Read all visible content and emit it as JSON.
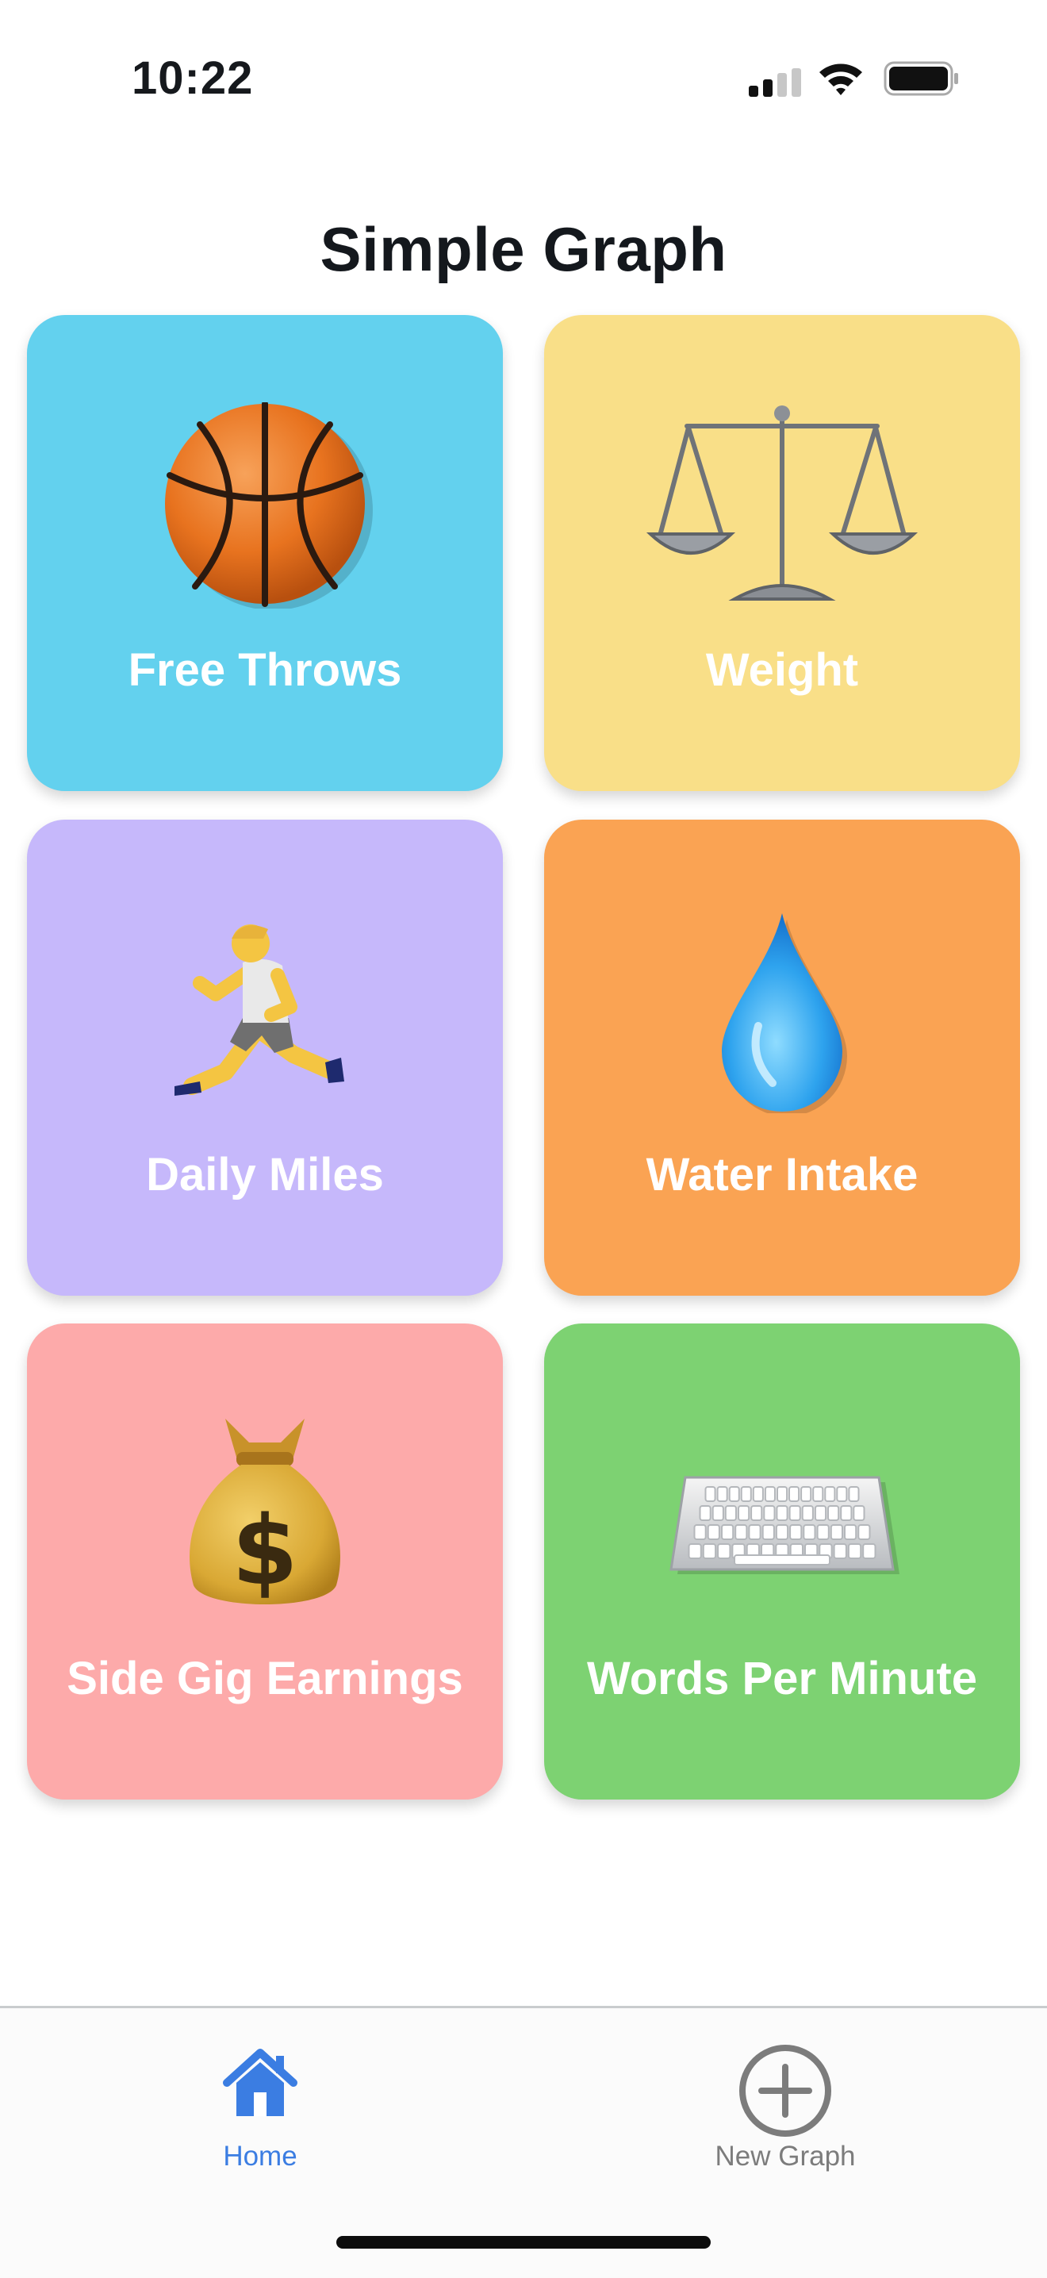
{
  "status_bar": {
    "time": "10:22"
  },
  "title": "Simple Graph",
  "tiles": [
    {
      "label": "Free Throws",
      "icon": "basketball-icon",
      "color": "#63d1ee"
    },
    {
      "label": "Weight",
      "icon": "balance-scale-icon",
      "color": "#f9df88"
    },
    {
      "label": "Daily Miles",
      "icon": "runner-icon",
      "color": "#c6b8fb"
    },
    {
      "label": "Water Intake",
      "icon": "water-drop-icon",
      "color": "#faa353"
    },
    {
      "label": "Side Gig Earnings",
      "icon": "money-bag-icon",
      "color": "#fdaaaa"
    },
    {
      "label": "Words Per Minute",
      "icon": "keyboard-icon",
      "color": "#7dd272"
    }
  ],
  "tab_bar": {
    "home_label": "Home",
    "new_graph_label": "New Graph",
    "active_tab": "Home",
    "active_color": "#3b7de2",
    "inactive_color": "#7c7c7c"
  }
}
